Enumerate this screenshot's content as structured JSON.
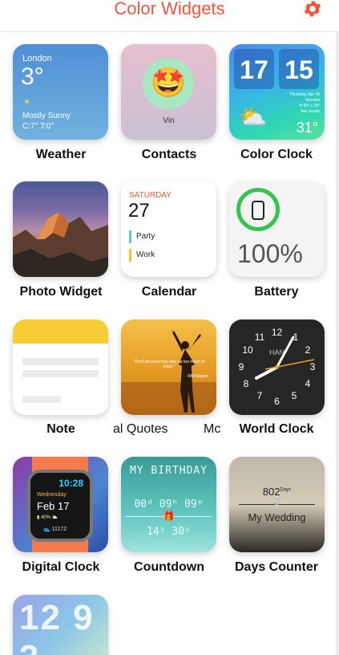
{
  "header": {
    "title": "Color Widgets",
    "settings_icon": "gear-icon",
    "accent": "#f0553e"
  },
  "weather": {
    "city": "London",
    "temp": "3°",
    "condition": "Mostly Sunny",
    "range": "C:7° T:0°",
    "label": "Weather"
  },
  "contacts": {
    "emoji": "🤩",
    "name": "Vin",
    "label": "Contacts"
  },
  "color_clock": {
    "hour": "17",
    "minute": "15",
    "date": "Thursday, Apr 29",
    "location": "Mumbai",
    "hilo": "H:30° L:18°",
    "sky": "few clouds",
    "temp": "31°",
    "label": "Color Clock"
  },
  "photo": {
    "label": "Photo Widget"
  },
  "calendar": {
    "day": "SATURDAY",
    "date": "27",
    "events": [
      "Party",
      "Work"
    ],
    "label": "Calendar"
  },
  "battery": {
    "percent": "100%",
    "label": "Battery"
  },
  "note": {
    "label": "Note"
  },
  "quotes": {
    "quote": "\"Don't let yesterday take up too much of today.\"",
    "author": "-Will Rogers",
    "label": "al Quotes",
    "label_next": "Mc"
  },
  "world_clock": {
    "city": "HAN",
    "numerals": [
      "12",
      "1",
      "2",
      "3",
      "4",
      "5",
      "6",
      "7",
      "8",
      "9",
      "10",
      "11"
    ],
    "label": "World Clock"
  },
  "digital_clock": {
    "time": "10:28",
    "weekday": "Wednesday",
    "date": "Feb 17",
    "battery": "40%",
    "steps": "11172",
    "label": "Digital Clock"
  },
  "countdown": {
    "title": "MY BIRTHDAY",
    "d": "00",
    "h": "09",
    "m": "09",
    "s1": "14",
    "s2": "30",
    "label": "Countdown"
  },
  "days_counter": {
    "count": "802",
    "unit": "Days",
    "event": "My Wedding",
    "label": "Days Counter"
  },
  "partial_clock": {
    "digits": "12 9 3"
  }
}
